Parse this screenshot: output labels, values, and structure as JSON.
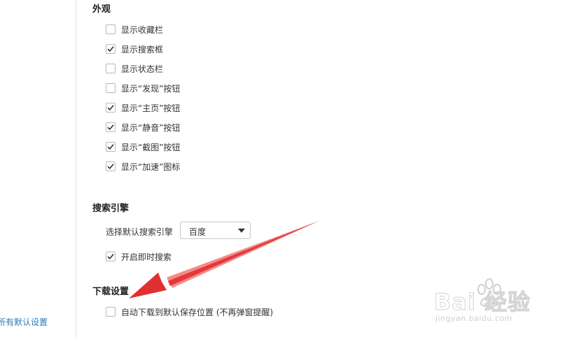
{
  "sidebar": {
    "reset_link": "所有默认设置"
  },
  "appearance": {
    "title": "外观",
    "items": [
      {
        "label": "显示收藏栏",
        "checked": false
      },
      {
        "label": "显示搜索框",
        "checked": true
      },
      {
        "label": "显示状态栏",
        "checked": false
      },
      {
        "label": "显示“发现”按钮",
        "checked": false
      },
      {
        "label": "显示“主页”按钮",
        "checked": true
      },
      {
        "label": "显示“静音”按钮",
        "checked": true
      },
      {
        "label": "显示“截图”按钮",
        "checked": true
      },
      {
        "label": "显示“加速”图标",
        "checked": true
      }
    ]
  },
  "search_engine": {
    "title": "搜索引擎",
    "select_label": "选择默认搜索引擎",
    "selected": "百度",
    "instant_search": {
      "label": "开启即时搜索",
      "checked": true
    }
  },
  "download": {
    "title": "下载设置",
    "auto_download": {
      "label": "自动下载到默认保存位置 (不再弹窗提醒)",
      "checked": false
    }
  },
  "watermark": {
    "brand": "Bai 经验",
    "url": "jingyan.baidu.com"
  },
  "colors": {
    "annotation_arrow": "#e03030",
    "link": "#2a7ab8"
  }
}
